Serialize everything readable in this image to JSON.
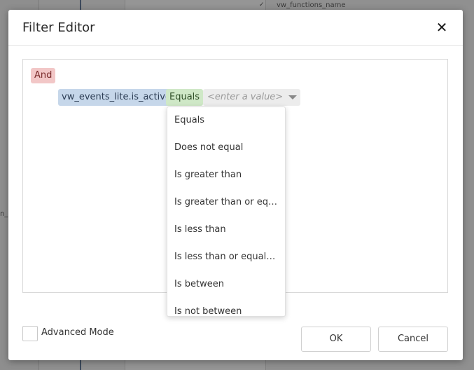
{
  "background": {
    "visible_column_text": "vw_functions_name",
    "side_text": "n_"
  },
  "dialog": {
    "title": "Filter Editor",
    "close_icon": "close-icon"
  },
  "filter": {
    "group_operator": "And",
    "condition": {
      "field": "vw_events_lite.is_active",
      "operator": "Equals",
      "value_placeholder": "<enter a value>"
    }
  },
  "operator_dropdown": {
    "items": [
      "Equals",
      "Does not equal",
      "Is greater than",
      "Is greater than or equal to",
      "Is less than",
      "Is less than or equal to",
      "Is between",
      "Is not between"
    ]
  },
  "footer": {
    "advanced_mode_label": "Advanced Mode",
    "advanced_mode_checked": false,
    "ok_label": "OK",
    "cancel_label": "Cancel"
  },
  "colors": {
    "group_chip": "#f2c7c7",
    "field_chip": "#c6d7ea",
    "operator_chip": "#cfe8c7",
    "value_editor": "#ececec"
  }
}
